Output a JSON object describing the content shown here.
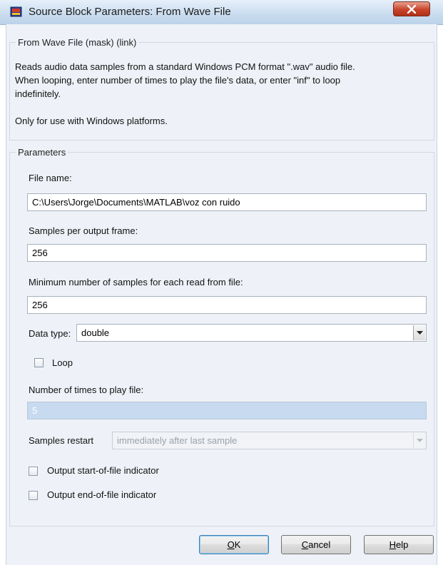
{
  "window": {
    "title": "Source Block Parameters: From Wave File"
  },
  "description_group": {
    "legend": "From Wave File (mask) (link)",
    "text_line1": "Reads audio data samples from a standard Windows PCM format \".wav\" audio file.",
    "text_line2": "When looping, enter number of times to play the file's data, or enter \"inf\" to loop",
    "text_line3": "indefinitely.",
    "text_line4": "Only for use with Windows platforms."
  },
  "parameters": {
    "legend": "Parameters",
    "file_name": {
      "label": "File name:",
      "value": "C:\\Users\\Jorge\\Documents\\MATLAB\\voz con ruido"
    },
    "samples_per_frame": {
      "label": "Samples per output frame:",
      "value": "256"
    },
    "min_samples": {
      "label": "Minimum number of samples for each read from file:",
      "value": "256"
    },
    "data_type": {
      "label": "Data type:",
      "value": "double"
    },
    "loop": {
      "label": "Loop",
      "checked": false
    },
    "times_to_play": {
      "label": "Number of times to play file:",
      "value": "5",
      "disabled": true
    },
    "samples_restart": {
      "label": "Samples restart",
      "value": "immediately after last sample",
      "disabled": true
    },
    "start_indicator": {
      "label": "Output start-of-file indicator",
      "checked": false
    },
    "end_indicator": {
      "label": "Output end-of-file indicator",
      "checked": false
    }
  },
  "buttons": {
    "ok_first": "O",
    "ok_rest": "K",
    "cancel_first": "C",
    "cancel_rest": "ancel",
    "help_first": "H",
    "help_rest": "elp"
  },
  "colors": {
    "close_button": "#c8442a",
    "disabled_field": "#c7daf0",
    "dialog_background": "#eef2f8"
  },
  "icons": {
    "app": "simulink-block-icon",
    "close": "close-x-icon",
    "dropdown": "chevron-down-icon"
  }
}
